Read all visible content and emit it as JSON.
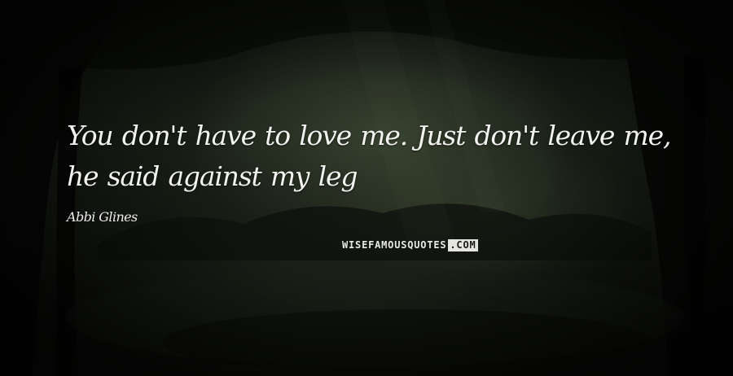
{
  "quote": {
    "text": "You don't have to love me. Just don't leave me, he said against my leg",
    "author": "Abbi Glines"
  },
  "watermark": {
    "main": "WISEFAMOUSQUOTES",
    "suffix": ".COM"
  },
  "colors": {
    "text": "#f2f2ee",
    "background": "#161a13",
    "watermark_box": "#e5e5df"
  },
  "background_image": "dark-forest-photo"
}
